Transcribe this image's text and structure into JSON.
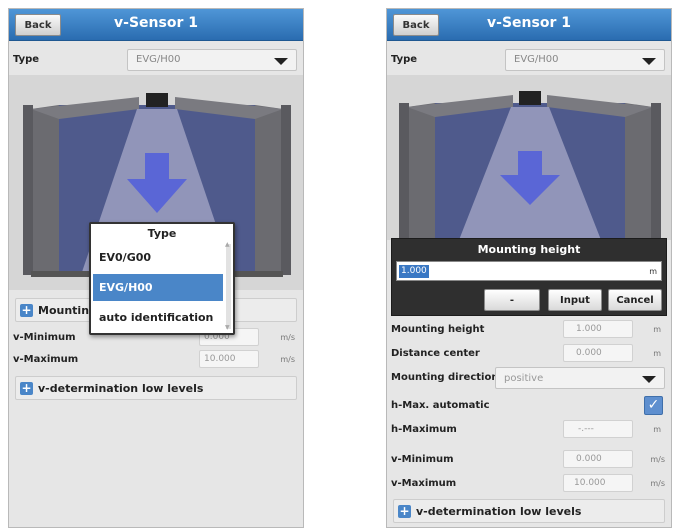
{
  "left": {
    "back_label": "Back",
    "title": "v-Sensor 1",
    "type_label": "Type",
    "type_value": "EVG/H00",
    "popup": {
      "title": "Type",
      "options": [
        {
          "label": "EV0/G00",
          "selected": false
        },
        {
          "label": "EVG/H00",
          "selected": true
        },
        {
          "label": "auto identification",
          "selected": false
        }
      ]
    },
    "mounting_section": "Mounting",
    "v_min": {
      "label": "v-Minimum",
      "value": "0.000",
      "unit": "m/s"
    },
    "v_max": {
      "label": "v-Maximum",
      "value": "10.000",
      "unit": "m/s"
    },
    "low_levels": "v-determination low levels"
  },
  "right": {
    "back_label": "Back",
    "title": "v-Sensor 1",
    "type_label": "Type",
    "type_value": "EVG/H00",
    "dialog": {
      "title": "Mounting height",
      "value": "1.000",
      "unit": "m",
      "minus_label": "-",
      "input_label": "Input",
      "cancel_label": "Cancel"
    },
    "mounting_height": {
      "label": "Mounting height",
      "value": "1.000",
      "unit": "m"
    },
    "distance_center": {
      "label": "Distance center",
      "value": "0.000",
      "unit": "m"
    },
    "mounting_direction": {
      "label": "Mounting direction",
      "value": "positive"
    },
    "hmax_auto": {
      "label": "h-Max. automatic",
      "checked": true
    },
    "h_max": {
      "label": "h-Maximum",
      "value": "-.---",
      "unit": "m"
    },
    "v_min": {
      "label": "v-Minimum",
      "value": "0.000",
      "unit": "m/s"
    },
    "v_max": {
      "label": "v-Maximum",
      "value": "10.000",
      "unit": "m/s"
    },
    "low_levels": "v-determination low levels"
  },
  "icons": [
    "plus-icon",
    "chevron-down-icon",
    "checkmark-icon",
    "sensor-icon",
    "flow-arrow-icon"
  ],
  "colors": {
    "titlebar": "#2a6cb0",
    "selected": "#4a86c8",
    "flow_arrow": "#5a66d6"
  }
}
